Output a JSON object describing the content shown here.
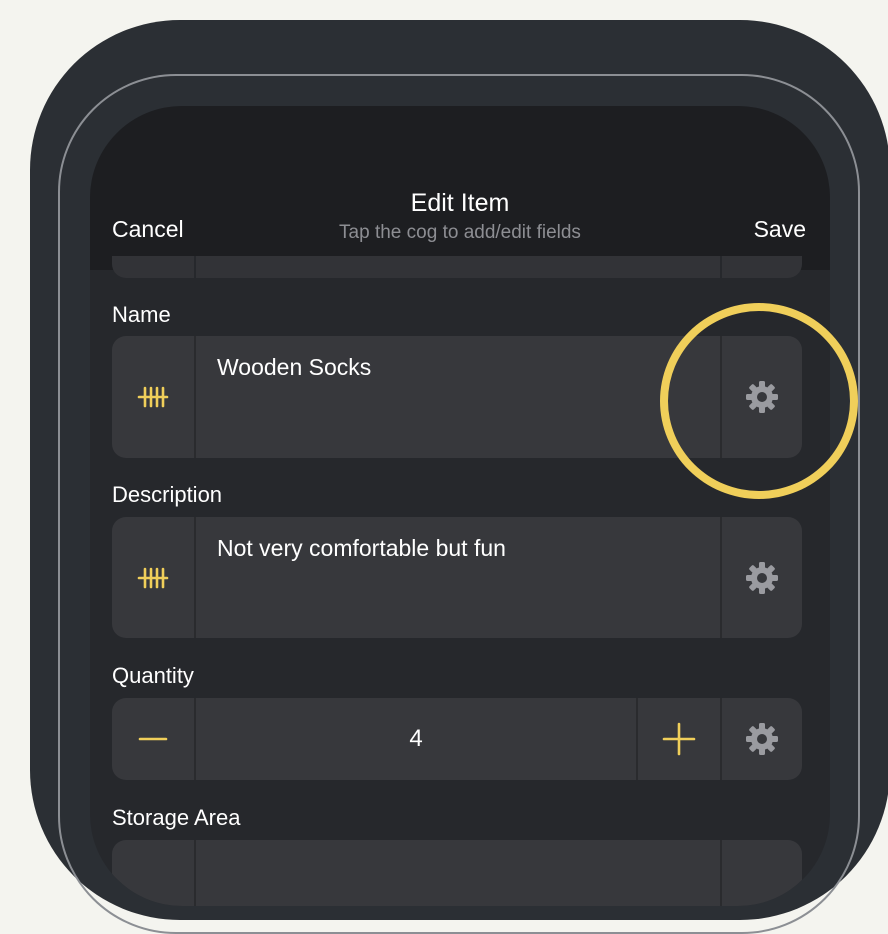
{
  "navbar": {
    "cancel_label": "Cancel",
    "title": "Edit Item",
    "subtitle": "Tap the cog to add/edit fields",
    "save_label": "Save"
  },
  "fields": {
    "name": {
      "label": "Name",
      "value": "Wooden Socks"
    },
    "description": {
      "label": "Description",
      "value": "Not very comfortable but fun"
    },
    "quantity": {
      "label": "Quantity",
      "value": "4"
    },
    "storage_area": {
      "label": "Storage Area"
    }
  },
  "icons": {
    "field_type": "tally-marks-icon",
    "settings": "gear-icon",
    "decrement": "minus-icon",
    "increment": "plus-icon"
  },
  "colors": {
    "accent": "#f0cf5a",
    "gear": "#9a9ba0",
    "card": "#37383c",
    "navbar": "#1d1e21",
    "screen": "#26282c"
  }
}
